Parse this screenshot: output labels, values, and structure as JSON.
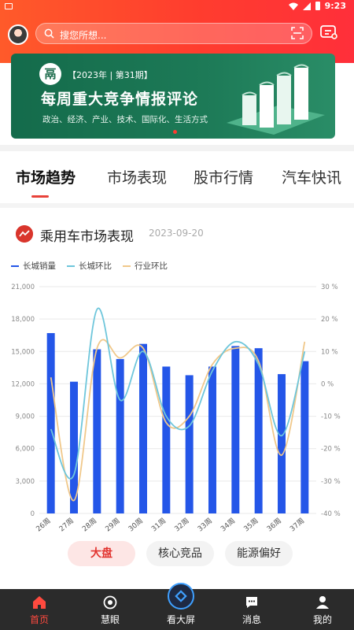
{
  "status_bar": {
    "time": "9:23"
  },
  "header": {
    "search_placeholder": "搜您所想..."
  },
  "banner": {
    "logo_text": "鬲",
    "issue": "【2023年 | 第31期】",
    "title": "每周重大竞争情报评论",
    "subtitle": "政治、经济、产业、技术、国际化、生活方式"
  },
  "tabs": [
    {
      "label": "市场趋势",
      "active": true
    },
    {
      "label": "市场表现",
      "active": false
    },
    {
      "label": "股市行情",
      "active": false
    },
    {
      "label": "汽车快讯",
      "active": false
    }
  ],
  "section": {
    "title": "乘用车市场表现",
    "date": "2023-09-20"
  },
  "colors": {
    "bar": "#2456e8",
    "line_brand": "#6ec6db",
    "line_industry": "#f0c88a",
    "accent": "#e2332e"
  },
  "chart_data": {
    "type": "bar",
    "categories": [
      "26周",
      "27周",
      "28周",
      "29周",
      "30周",
      "31周",
      "32周",
      "33周",
      "34周",
      "35周",
      "36周",
      "37周"
    ],
    "series": [
      {
        "name": "长城销量",
        "type": "bar",
        "axis": "left",
        "values": [
          16700,
          12200,
          15200,
          14300,
          15700,
          13600,
          12800,
          13600,
          15500,
          15300,
          12900,
          14100
        ]
      },
      {
        "name": "长城环比",
        "type": "line",
        "axis": "right",
        "values": [
          -14,
          -28,
          23,
          -5,
          10,
          -10,
          -13,
          4,
          13,
          6,
          -16,
          10
        ]
      },
      {
        "name": "行业环比",
        "type": "line",
        "axis": "right",
        "values": [
          2,
          -36,
          11,
          8,
          11,
          -12,
          -10,
          6,
          11,
          7,
          -22,
          13
        ]
      }
    ],
    "y_left": {
      "min": 0,
      "max": 21000,
      "ticks": [
        "0",
        "3,000",
        "6,000",
        "9,000",
        "12,000",
        "15,000",
        "18,000",
        "21,000"
      ]
    },
    "y_right": {
      "min": -40,
      "max": 30,
      "ticks": [
        "-40 %",
        "-30 %",
        "-20 %",
        "-10 %",
        "0 %",
        "10 %",
        "20 %",
        "30 %"
      ]
    },
    "legend": [
      "长城销量",
      "长城环比",
      "行业环比"
    ],
    "legend_position": "top-left",
    "grid": true
  },
  "filters": [
    {
      "label": "大盘",
      "active": true
    },
    {
      "label": "核心竞品",
      "active": false
    },
    {
      "label": "能源偏好",
      "active": false
    }
  ],
  "nav": [
    {
      "label": "首页",
      "active": true
    },
    {
      "label": "慧眼",
      "active": false
    },
    {
      "label": "看大屏",
      "active": false
    },
    {
      "label": "消息",
      "active": false
    },
    {
      "label": "我的",
      "active": false
    }
  ]
}
